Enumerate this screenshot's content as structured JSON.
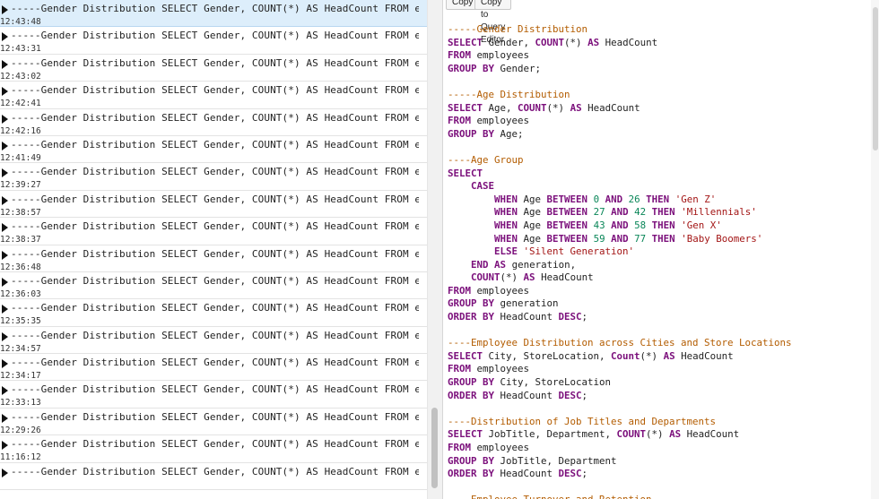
{
  "history": {
    "items": [
      {
        "query": "-----Gender Distribution SELECT Gender, COUNT(*) AS HeadCount FROM employees",
        "time": "12:43:48"
      },
      {
        "query": "-----Gender Distribution SELECT Gender, COUNT(*) AS HeadCount FROM employees",
        "time": "12:43:31"
      },
      {
        "query": "-----Gender Distribution SELECT Gender, COUNT(*) AS HeadCount FROM employees",
        "time": "12:43:02"
      },
      {
        "query": "-----Gender Distribution SELECT Gender, COUNT(*) AS HeadCount FROM employees",
        "time": "12:42:41"
      },
      {
        "query": "-----Gender Distribution SELECT Gender, COUNT(*) AS HeadCount FROM employees",
        "time": "12:42:16"
      },
      {
        "query": "-----Gender Distribution SELECT Gender, COUNT(*) AS HeadCount FROM employees",
        "time": "12:41:49"
      },
      {
        "query": "-----Gender Distribution SELECT Gender, COUNT(*) AS HeadCount FROM employees",
        "time": "12:39:27"
      },
      {
        "query": "-----Gender Distribution SELECT Gender, COUNT(*) AS HeadCount FROM employees",
        "time": "12:38:57"
      },
      {
        "query": "-----Gender Distribution SELECT Gender, COUNT(*) AS HeadCount FROM employees",
        "time": "12:38:37"
      },
      {
        "query": "-----Gender Distribution SELECT Gender, COUNT(*) AS HeadCount FROM employees",
        "time": "12:36:48"
      },
      {
        "query": "-----Gender Distribution SELECT Gender, COUNT(*) AS HeadCount FROM employees",
        "time": "12:36:03"
      },
      {
        "query": "-----Gender Distribution SELECT Gender, COUNT(*) AS HeadCount FROM employees",
        "time": "12:35:35"
      },
      {
        "query": "-----Gender Distribution SELECT Gender, COUNT(*) AS HeadCount FROM employees",
        "time": "12:34:57"
      },
      {
        "query": "-----Gender Distribution SELECT Gender, COUNT(*) AS HeadCount FROM employees",
        "time": "12:34:17"
      },
      {
        "query": "-----Gender Distribution SELECT Gender, COUNT(*) AS HeadCount FROM employees",
        "time": "12:33:13"
      },
      {
        "query": "-----Gender Distribution SELECT Gender, COUNT(*) AS HeadCount FROM employees",
        "time": "12:29:26"
      },
      {
        "query": "-----Gender Distribution SELECT Gender, COUNT(*) AS HeadCount FROM employees",
        "time": "11:16:12"
      },
      {
        "query": "-----Gender Distribution SELECT Gender, COUNT(*) AS HeadCount FROM employees",
        "time": ""
      }
    ]
  },
  "toolbar": {
    "copy_label": "Copy",
    "copy_to_editor_label": "Copy to Query Editor"
  },
  "code_lines": [
    [
      [
        "cm",
        "-----Gender Distribution"
      ]
    ],
    [
      [
        "kw",
        "SELECT"
      ],
      [
        "pl",
        " Gender, "
      ],
      [
        "fn",
        "COUNT"
      ],
      [
        "pl",
        "(*) "
      ],
      [
        "kw",
        "AS"
      ],
      [
        "pl",
        " HeadCount"
      ]
    ],
    [
      [
        "kw",
        "FROM"
      ],
      [
        "pl",
        " employees"
      ]
    ],
    [
      [
        "kw",
        "GROUP BY"
      ],
      [
        "pl",
        " Gender;"
      ]
    ],
    [],
    [
      [
        "cm",
        "-----Age Distribution"
      ]
    ],
    [
      [
        "kw",
        "SELECT"
      ],
      [
        "pl",
        " Age, "
      ],
      [
        "fn",
        "COUNT"
      ],
      [
        "pl",
        "(*) "
      ],
      [
        "kw",
        "AS"
      ],
      [
        "pl",
        " HeadCount"
      ]
    ],
    [
      [
        "kw",
        "FROM"
      ],
      [
        "pl",
        " employees"
      ]
    ],
    [
      [
        "kw",
        "GROUP BY"
      ],
      [
        "pl",
        " Age;"
      ]
    ],
    [],
    [
      [
        "cm",
        "----Age Group"
      ]
    ],
    [
      [
        "kw",
        "SELECT"
      ]
    ],
    [
      [
        "pl",
        "    "
      ],
      [
        "kw",
        "CASE"
      ]
    ],
    [
      [
        "pl",
        "        "
      ],
      [
        "kw",
        "WHEN"
      ],
      [
        "pl",
        " Age "
      ],
      [
        "kw",
        "BETWEEN"
      ],
      [
        "pl",
        " "
      ],
      [
        "num",
        "0"
      ],
      [
        "pl",
        " "
      ],
      [
        "kw",
        "AND"
      ],
      [
        "pl",
        " "
      ],
      [
        "num",
        "26"
      ],
      [
        "pl",
        " "
      ],
      [
        "kw",
        "THEN"
      ],
      [
        "pl",
        " "
      ],
      [
        "str",
        "'Gen Z'"
      ]
    ],
    [
      [
        "pl",
        "        "
      ],
      [
        "kw",
        "WHEN"
      ],
      [
        "pl",
        " Age "
      ],
      [
        "kw",
        "BETWEEN"
      ],
      [
        "pl",
        " "
      ],
      [
        "num",
        "27"
      ],
      [
        "pl",
        " "
      ],
      [
        "kw",
        "AND"
      ],
      [
        "pl",
        " "
      ],
      [
        "num",
        "42"
      ],
      [
        "pl",
        " "
      ],
      [
        "kw",
        "THEN"
      ],
      [
        "pl",
        " "
      ],
      [
        "str",
        "'Millennials'"
      ]
    ],
    [
      [
        "pl",
        "        "
      ],
      [
        "kw",
        "WHEN"
      ],
      [
        "pl",
        " Age "
      ],
      [
        "kw",
        "BETWEEN"
      ],
      [
        "pl",
        " "
      ],
      [
        "num",
        "43"
      ],
      [
        "pl",
        " "
      ],
      [
        "kw",
        "AND"
      ],
      [
        "pl",
        " "
      ],
      [
        "num",
        "58"
      ],
      [
        "pl",
        " "
      ],
      [
        "kw",
        "THEN"
      ],
      [
        "pl",
        " "
      ],
      [
        "str",
        "'Gen X'"
      ]
    ],
    [
      [
        "pl",
        "        "
      ],
      [
        "kw",
        "WHEN"
      ],
      [
        "pl",
        " Age "
      ],
      [
        "kw",
        "BETWEEN"
      ],
      [
        "pl",
        " "
      ],
      [
        "num",
        "59"
      ],
      [
        "pl",
        " "
      ],
      [
        "kw",
        "AND"
      ],
      [
        "pl",
        " "
      ],
      [
        "num",
        "77"
      ],
      [
        "pl",
        " "
      ],
      [
        "kw",
        "THEN"
      ],
      [
        "pl",
        " "
      ],
      [
        "str",
        "'Baby Boomers'"
      ]
    ],
    [
      [
        "pl",
        "        "
      ],
      [
        "kw",
        "ELSE"
      ],
      [
        "pl",
        " "
      ],
      [
        "str",
        "'Silent Generation'"
      ]
    ],
    [
      [
        "pl",
        "    "
      ],
      [
        "kw",
        "END"
      ],
      [
        "pl",
        " "
      ],
      [
        "kw",
        "AS"
      ],
      [
        "pl",
        " generation,"
      ]
    ],
    [
      [
        "pl",
        "    "
      ],
      [
        "fn",
        "COUNT"
      ],
      [
        "pl",
        "(*) "
      ],
      [
        "kw",
        "AS"
      ],
      [
        "pl",
        " HeadCount"
      ]
    ],
    [
      [
        "kw",
        "FROM"
      ],
      [
        "pl",
        " employees"
      ]
    ],
    [
      [
        "kw",
        "GROUP BY"
      ],
      [
        "pl",
        " generation"
      ]
    ],
    [
      [
        "kw",
        "ORDER BY"
      ],
      [
        "pl",
        " HeadCount "
      ],
      [
        "kw",
        "DESC"
      ],
      [
        "pl",
        ";"
      ]
    ],
    [],
    [
      [
        "cm",
        "----Employee Distribution across Cities and Store Locations"
      ]
    ],
    [
      [
        "kw",
        "SELECT"
      ],
      [
        "pl",
        " City, StoreLocation, "
      ],
      [
        "fn",
        "Count"
      ],
      [
        "pl",
        "(*) "
      ],
      [
        "kw",
        "AS"
      ],
      [
        "pl",
        " HeadCount"
      ]
    ],
    [
      [
        "kw",
        "FROM"
      ],
      [
        "pl",
        " employees"
      ]
    ],
    [
      [
        "kw",
        "GROUP BY"
      ],
      [
        "pl",
        " City, StoreLocation"
      ]
    ],
    [
      [
        "kw",
        "ORDER BY"
      ],
      [
        "pl",
        " HeadCount "
      ],
      [
        "kw",
        "DESC"
      ],
      [
        "pl",
        ";"
      ]
    ],
    [],
    [
      [
        "cm",
        "----Distribution of Job Titles and Departments"
      ]
    ],
    [
      [
        "kw",
        "SELECT"
      ],
      [
        "pl",
        " JobTitle, Department, "
      ],
      [
        "fn",
        "COUNT"
      ],
      [
        "pl",
        "(*) "
      ],
      [
        "kw",
        "AS"
      ],
      [
        "pl",
        " HeadCount"
      ]
    ],
    [
      [
        "kw",
        "FROM"
      ],
      [
        "pl",
        " employees"
      ]
    ],
    [
      [
        "kw",
        "GROUP BY"
      ],
      [
        "pl",
        " JobTitle, Department"
      ]
    ],
    [
      [
        "kw",
        "ORDER BY"
      ],
      [
        "pl",
        " HeadCount "
      ],
      [
        "kw",
        "DESC"
      ],
      [
        "pl",
        ";"
      ]
    ],
    [],
    [
      [
        "cm",
        "----Employee Turnover and Retention"
      ]
    ]
  ]
}
